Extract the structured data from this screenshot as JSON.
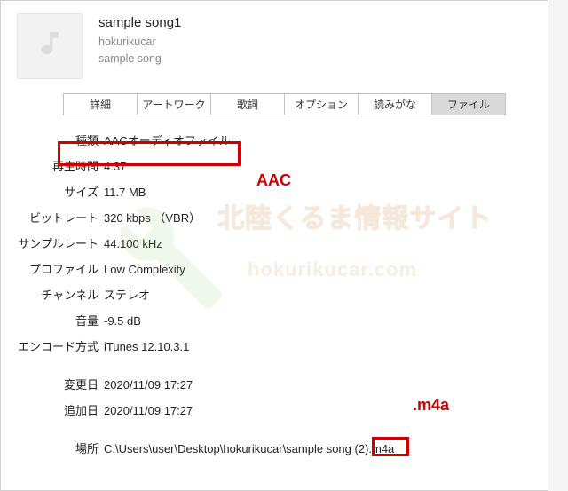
{
  "header": {
    "title": "sample song1",
    "artist": "hokurikucar",
    "album": "sample song"
  },
  "tabs": {
    "items": [
      "詳細",
      "アートワーク",
      "歌詞",
      "オプション",
      "読みがな",
      "ファイル"
    ],
    "active_index": 5
  },
  "fields": {
    "kind_label": "種類",
    "kind_value": "AACオーディオファイル",
    "duration_label": "再生時間",
    "duration_value": "4:37",
    "size_label": "サイズ",
    "size_value": "11.7 MB",
    "bitrate_label": "ビットレート",
    "bitrate_value": "320 kbps （VBR）",
    "samplerate_label": "サンプルレート",
    "samplerate_value": "44.100 kHz",
    "profile_label": "プロファイル",
    "profile_value": "Low Complexity",
    "channels_label": "チャンネル",
    "channels_value": "ステレオ",
    "volume_label": "音量",
    "volume_value": "-9.5 dB",
    "encoder_label": "エンコード方式",
    "encoder_value": "iTunes 12.10.3.1",
    "modified_label": "変更日",
    "modified_value": "2020/11/09 17:27",
    "added_label": "追加日",
    "added_value": "2020/11/09 17:27",
    "location_label": "場所",
    "location_value": "C:\\Users\\user\\Desktop\\hokurikucar\\sample song (2).m4a"
  },
  "annotations": {
    "aac": "AAC",
    "m4a": ".m4a"
  },
  "watermark": {
    "jp": "北陸くるま情報サイト",
    "en": "hokurikucar.com"
  }
}
